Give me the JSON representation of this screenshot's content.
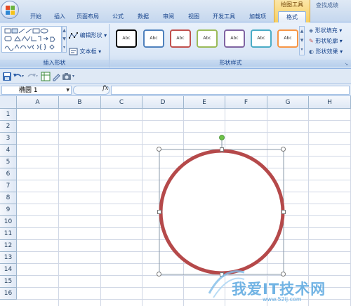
{
  "app": {
    "window_caption": "查找成绩",
    "context_group_title": "绘图工具"
  },
  "tabs": [
    {
      "label": "开始",
      "active": false
    },
    {
      "label": "插入",
      "active": false
    },
    {
      "label": "页面布局",
      "active": false
    },
    {
      "label": "公式",
      "active": false
    },
    {
      "label": "数据",
      "active": false
    },
    {
      "label": "审阅",
      "active": false
    },
    {
      "label": "视图",
      "active": false
    },
    {
      "label": "开发工具",
      "active": false
    },
    {
      "label": "加载项",
      "active": false
    },
    {
      "label": "格式",
      "active": true
    }
  ],
  "ribbon": {
    "insert_shapes": {
      "label": "插入形状",
      "edit_shape": "编辑形状",
      "text_box": "文本框"
    },
    "shape_styles": {
      "label": "形状样式",
      "preset_text": "Abc",
      "preset_borders": [
        "#000000",
        "#4f81bd",
        "#c0504d",
        "#9bbb59",
        "#8064a2",
        "#4bacc6",
        "#f79646"
      ],
      "shape_fill": "形状填充",
      "shape_outline": "形状轮廓",
      "shape_effects": "形状效果"
    }
  },
  "formula_bar": {
    "name_box": "椭圆 1",
    "fx": "fx",
    "value": ""
  },
  "grid": {
    "columns": [
      "A",
      "B",
      "C",
      "D",
      "E",
      "F",
      "G",
      "H"
    ],
    "rows": [
      "1",
      "2",
      "3",
      "4",
      "5",
      "6",
      "7",
      "8",
      "9",
      "10",
      "11",
      "12",
      "13",
      "14",
      "15",
      "16"
    ]
  },
  "shape": {
    "type": "ellipse",
    "name": "椭圆 1",
    "outline_color": "#b5494a",
    "fill": "#ffffff",
    "handle_color": "#6ec24a"
  },
  "watermark": {
    "text": "我爱IT技术网",
    "url": "www.52ij.com"
  }
}
